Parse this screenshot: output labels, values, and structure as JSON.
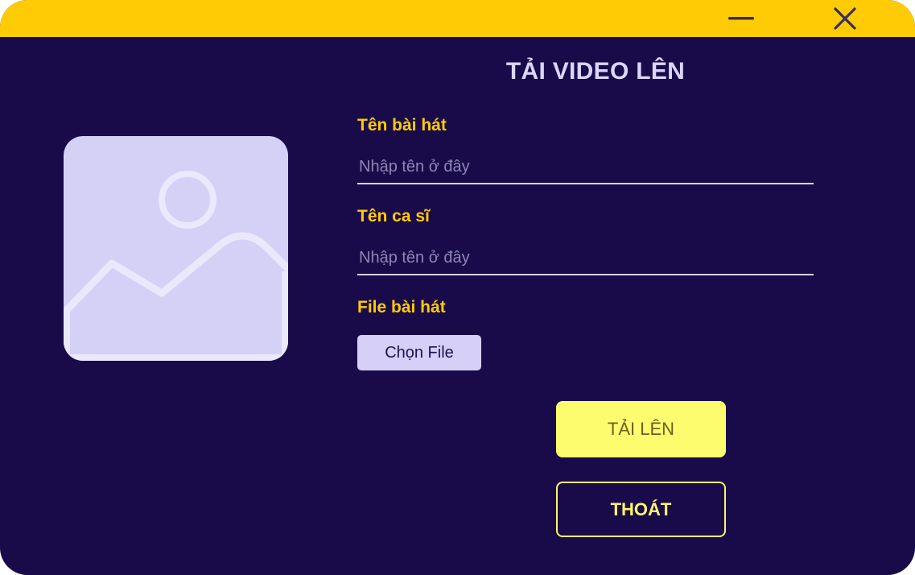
{
  "window": {
    "colors": {
      "background": "#190b4a",
      "titlebar": "#ffcb05",
      "accent_label": "#ffcb05"
    },
    "controls": {
      "minimize_icon": "minimize-icon",
      "close_icon": "close-icon"
    }
  },
  "preview": {
    "icon": "image-placeholder-icon"
  },
  "form": {
    "title": "TẢI VIDEO LÊN",
    "song_name": {
      "label": "Tên bài hát",
      "placeholder": "Nhập tên ở đây",
      "value": ""
    },
    "singer_name": {
      "label": "Tên ca sĩ",
      "placeholder": "Nhập tên ở đây",
      "value": ""
    },
    "song_file": {
      "label": "File bài hát",
      "button": "Chọn File"
    }
  },
  "actions": {
    "upload": "TẢI LÊN",
    "exit": "THOÁT"
  }
}
